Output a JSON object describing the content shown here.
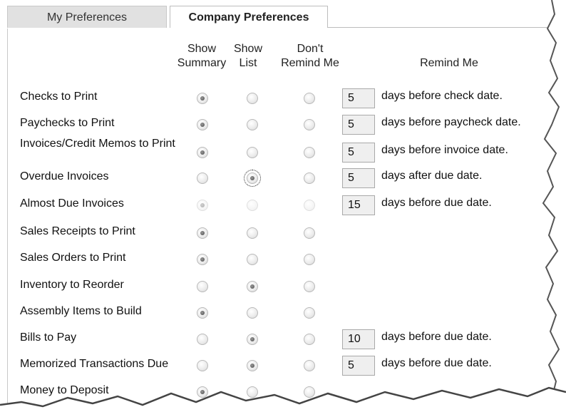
{
  "tabs": [
    {
      "label": "My Preferences"
    },
    {
      "label": "Company Preferences"
    }
  ],
  "columns": {
    "show_summary": [
      "Show",
      "Summary"
    ],
    "show_list": [
      "Show",
      "List"
    ],
    "dont_remind": [
      "Don't",
      "Remind Me"
    ],
    "remind_me": "Remind Me"
  },
  "rows": [
    {
      "label": "Checks to Print",
      "selected": "summary",
      "days": "5",
      "text": "days before check date."
    },
    {
      "label": "Paychecks to Print",
      "selected": "summary",
      "days": "5",
      "text": "days before paycheck date."
    },
    {
      "label": "Invoices/Credit Memos to Print",
      "selected": "summary",
      "days": "5",
      "text": "days before invoice date."
    },
    {
      "label": "Overdue Invoices",
      "selected": "list",
      "days": "5",
      "text": "days after due date."
    },
    {
      "label": "Almost Due Invoices",
      "selected": "summary",
      "disabled": true,
      "days": "15",
      "text": "days before due date."
    },
    {
      "label": "Sales Receipts to Print",
      "selected": "summary"
    },
    {
      "label": "Sales Orders to Print",
      "selected": "summary"
    },
    {
      "label": "Inventory to Reorder",
      "selected": "list"
    },
    {
      "label": "Assembly Items to Build",
      "selected": "summary"
    },
    {
      "label": "Bills to Pay",
      "selected": "list",
      "days": "10",
      "text": "days before due date."
    },
    {
      "label": "Memorized Transactions Due",
      "selected": "list",
      "days": "5",
      "text": "days before due date."
    },
    {
      "label": "Money to Deposit",
      "selected": "summary"
    }
  ]
}
